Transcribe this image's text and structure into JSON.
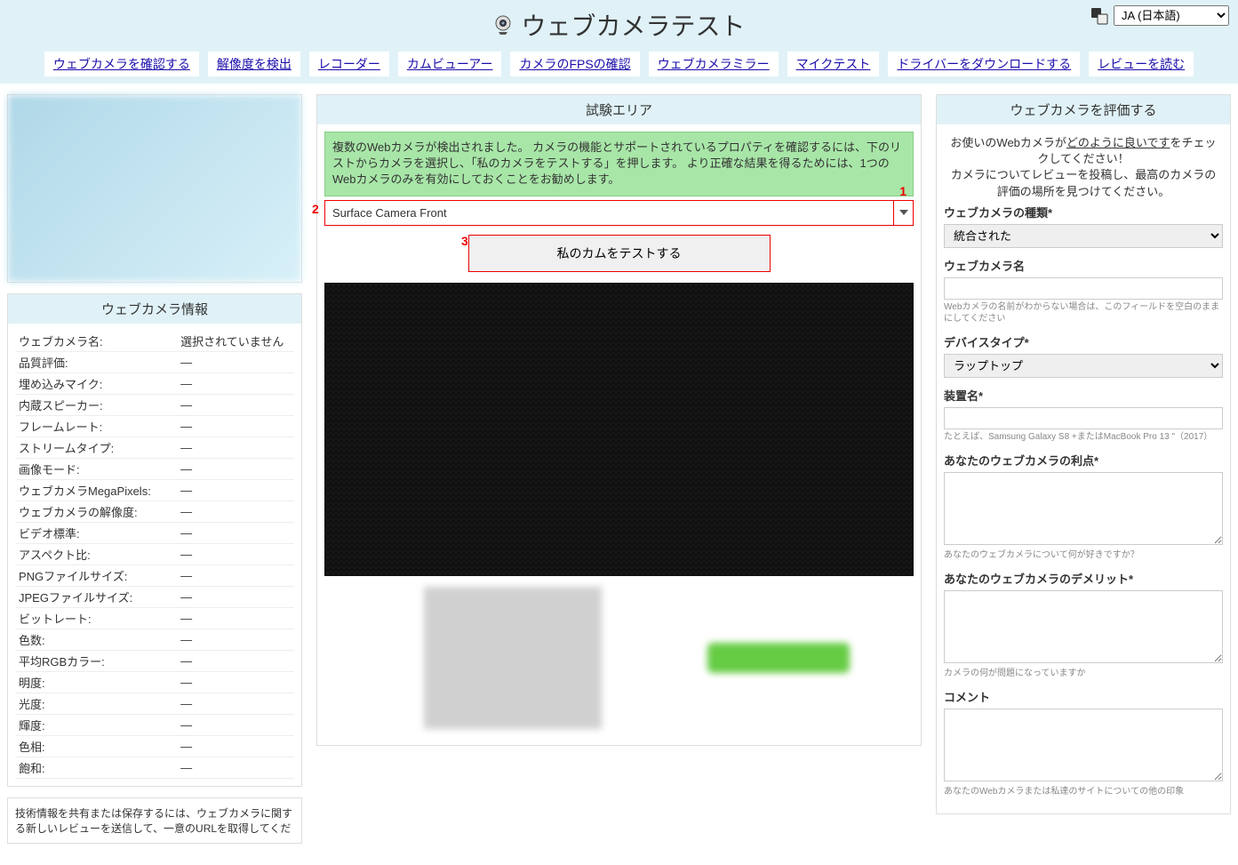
{
  "header": {
    "title": "ウェブカメラテスト",
    "lang_selected": "JA (日本語)"
  },
  "nav": [
    "ウェブカメラを確認する",
    "解像度を検出",
    "レコーダー",
    "カムビューアー",
    "カメラのFPSの確認",
    "ウェブカメラミラー",
    "マイクテスト",
    "ドライバーをダウンロードする",
    "レビューを読む"
  ],
  "left": {
    "info_title": "ウェブカメラ情報",
    "rows": [
      [
        "ウェブカメラ名:",
        "選択されていません"
      ],
      [
        "品質評価:",
        "—"
      ],
      [
        "埋め込みマイク:",
        "—"
      ],
      [
        "内蔵スピーカー:",
        "—"
      ],
      [
        "フレームレート:",
        "—"
      ],
      [
        "ストリームタイプ:",
        "—"
      ],
      [
        "画像モード:",
        "—"
      ],
      [
        "ウェブカメラMegaPixels:",
        "—"
      ],
      [
        "ウェブカメラの解像度:",
        "—"
      ],
      [
        "ビデオ標準:",
        "—"
      ],
      [
        "アスペクト比:",
        "—"
      ],
      [
        "PNGファイルサイズ:",
        "—"
      ],
      [
        "JPEGファイルサイズ:",
        "—"
      ],
      [
        "ビットレート:",
        "—"
      ],
      [
        "色数:",
        "—"
      ],
      [
        "平均RGBカラー:",
        "—"
      ],
      [
        "明度:",
        "—"
      ],
      [
        "光度:",
        "—"
      ],
      [
        "輝度:",
        "—"
      ],
      [
        "色相:",
        "—"
      ],
      [
        "飽和:",
        "—"
      ]
    ],
    "note": "技術情報を共有または保存するには、ウェブカメラに関する新しいレビューを送信して、一意のURLを取得してくだ"
  },
  "main": {
    "area_title": "試験エリア",
    "notice": "複数のWebカメラが検出されました。 カメラの機能とサポートされているプロパティを確認するには、下のリストからカメラを選択し、「私のカメラをテストする」を押します。 より正確な結果を得るためには、1つのWebカメラのみを有効にしておくことをお勧めします。",
    "step1": "1",
    "step2": "2",
    "step3": "3",
    "camera_selected": "Surface Camera Front",
    "test_btn": "私のカムをテストする"
  },
  "right": {
    "rate_title": "ウェブカメラを評価する",
    "intro1a": "お使いのWebカメラが",
    "intro1b": "どのように良いです",
    "intro1c": "をチェックしてください！",
    "intro2": "カメラについてレビューを投稿し、最高のカメラの評価の場所を見つけてください。",
    "f_type_label": "ウェブカメラの種類*",
    "f_type_value": "統合された",
    "f_name_label": "ウェブカメラ名",
    "f_name_hint": "Webカメラの名前がわからない場合は、このフィールドを空白のままにしてください",
    "f_device_label": "デバイスタイプ*",
    "f_device_value": "ラップトップ",
    "f_model_label": "装置名*",
    "f_model_hint": "たとえば、Samsung Galaxy S8 +またはMacBook Pro 13 \"（2017）",
    "f_pros_label": "あなたのウェブカメラの利点*",
    "f_pros_hint": "あなたのウェブカメラについて何が好きですか？",
    "f_cons_label": "あなたのウェブカメラのデメリット*",
    "f_cons_hint": "カメラの何が問題になっていますか",
    "f_comment_label": "コメント",
    "f_comment_hint": "あなたのWebカメラまたは私達のサイトについての他の印象"
  }
}
